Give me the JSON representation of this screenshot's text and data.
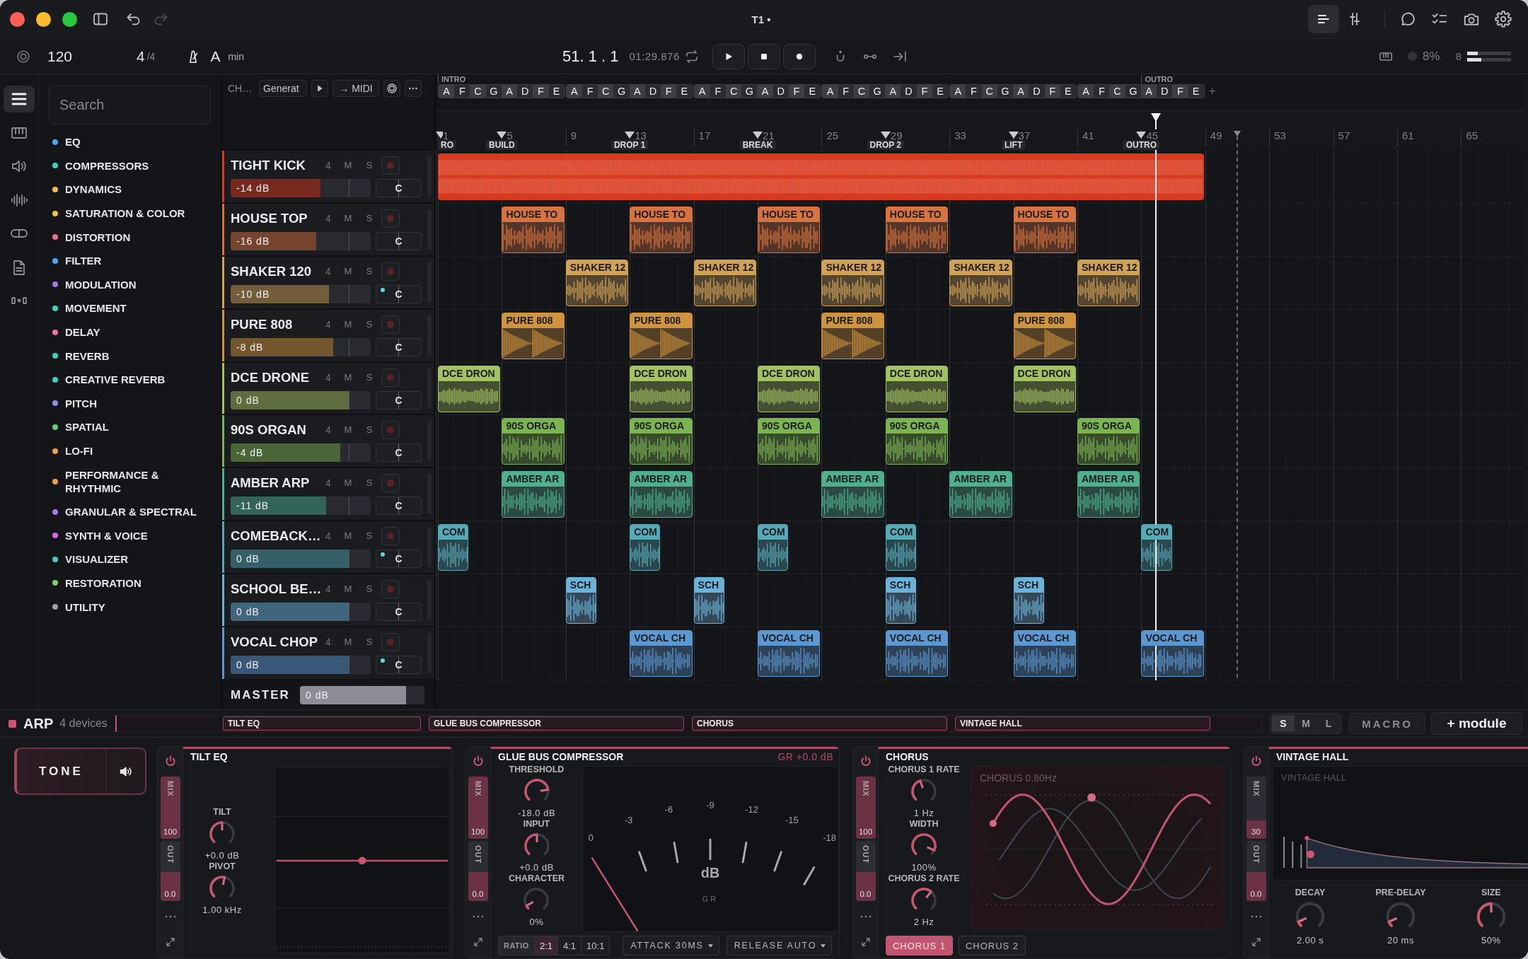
{
  "window": {
    "title": "T1 •"
  },
  "titlebar": {
    "history": [
      {
        "kind": "undo",
        "disabled": false
      },
      {
        "kind": "redo",
        "disabled": true
      }
    ],
    "views": [
      {
        "kind": "arrange",
        "selected": true
      },
      {
        "kind": "mixer",
        "selected": false
      }
    ],
    "tools": [
      {
        "kind": "comments"
      },
      {
        "kind": "tasks"
      },
      {
        "kind": "snapshot"
      },
      {
        "kind": "settings"
      }
    ]
  },
  "transport": {
    "tempo": "120",
    "beats": "4",
    "beat_unit": "/4",
    "key": "A",
    "scale": "min",
    "position": "51. 1 . 1",
    "time": "01:29.876",
    "cpu": "8%",
    "voices": "8",
    "output_meter": [
      {
        "level": 0.24
      },
      {
        "level": 0.32
      }
    ]
  },
  "rail": [
    {
      "kind": "browser",
      "selected": true
    },
    {
      "kind": "piano",
      "selected": false
    },
    {
      "kind": "audio",
      "selected": false
    },
    {
      "kind": "waveform",
      "selected": false
    },
    {
      "kind": "link",
      "selected": false
    },
    {
      "kind": "file",
      "selected": false
    },
    {
      "kind": "dots",
      "selected": false
    }
  ],
  "browser": {
    "search": {
      "placeholder": "Search"
    },
    "categories": [
      {
        "label": "EQ",
        "color": "#4aa8f0"
      },
      {
        "label": "COMPRESSORS",
        "color": "#3fd0bf"
      },
      {
        "label": "DYNAMICS",
        "color": "#f0c04a"
      },
      {
        "label": "SATURATION & COLOR",
        "color": "#f0c04a"
      },
      {
        "label": "DISTORTION",
        "color": "#f06a8a"
      },
      {
        "label": "FILTER",
        "color": "#4aa8f0"
      },
      {
        "label": "MODULATION",
        "color": "#a07cf0"
      },
      {
        "label": "MOVEMENT",
        "color": "#3fd0bf"
      },
      {
        "label": "DELAY",
        "color": "#f070a8"
      },
      {
        "label": "REVERB",
        "color": "#3fd0bf"
      },
      {
        "label": "CREATIVE REVERB",
        "color": "#3fd0bf"
      },
      {
        "label": "PITCH",
        "color": "#8c8cf0"
      },
      {
        "label": "SPATIAL",
        "color": "#62d070"
      },
      {
        "label": "LO-FI",
        "color": "#f0a040"
      },
      {
        "label": "PERFORMANCE & RHYTHMIC",
        "color": "#f0a040"
      },
      {
        "label": "GRANULAR & SPECTRAL",
        "color": "#a07cf0"
      },
      {
        "label": "SYNTH & VOICE",
        "color": "#e060e0"
      },
      {
        "label": "VISUALIZER",
        "color": "#3fd0bf"
      },
      {
        "label": "RESTORATION",
        "color": "#7ad060"
      },
      {
        "label": "UTILITY",
        "color": "#a0a1a8"
      }
    ]
  },
  "track_toolbar": {
    "label": "CH…",
    "generator": "Generat",
    "midi": "→ MIDI"
  },
  "chord_track": {
    "groups": [
      {
        "chords": [
          {
            "name": "A",
            "section": "INTRO"
          },
          {
            "name": "F"
          },
          {
            "name": "C"
          },
          {
            "name": "G"
          },
          {
            "name": "A"
          },
          {
            "name": "D"
          },
          {
            "name": "F"
          },
          {
            "name": "E"
          }
        ]
      },
      {
        "chords": [
          {
            "name": "A"
          },
          {
            "name": "F"
          },
          {
            "name": "C"
          },
          {
            "name": "G"
          },
          {
            "name": "A"
          },
          {
            "name": "D"
          },
          {
            "name": "F"
          },
          {
            "name": "E"
          }
        ]
      },
      {
        "chords": [
          {
            "name": "A"
          },
          {
            "name": "F"
          },
          {
            "name": "C"
          },
          {
            "name": "G"
          },
          {
            "name": "A"
          },
          {
            "name": "D"
          },
          {
            "name": "F"
          },
          {
            "name": "E"
          }
        ]
      },
      {
        "chords": [
          {
            "name": "A"
          },
          {
            "name": "F"
          },
          {
            "name": "C"
          },
          {
            "name": "G"
          },
          {
            "name": "A"
          },
          {
            "name": "D"
          },
          {
            "name": "F"
          },
          {
            "name": "E"
          }
        ]
      },
      {
        "chords": [
          {
            "name": "A"
          },
          {
            "name": "F"
          },
          {
            "name": "C"
          },
          {
            "name": "G"
          },
          {
            "name": "A"
          },
          {
            "name": "D"
          },
          {
            "name": "F"
          },
          {
            "name": "E"
          }
        ]
      },
      {
        "chords": [
          {
            "name": "A"
          },
          {
            "name": "F"
          },
          {
            "name": "C"
          },
          {
            "name": "G"
          },
          {
            "name": "A",
            "section": "OUTRO"
          },
          {
            "name": "D"
          },
          {
            "name": "F"
          },
          {
            "name": "E"
          }
        ]
      }
    ],
    "add": "+"
  },
  "ruler": {
    "numbers": [
      {
        "label": "1",
        "marker": "RO"
      },
      {
        "label": "5",
        "marker": "BUILD"
      },
      {
        "label": "9"
      },
      {
        "label": "13",
        "marker": "DROP 1"
      },
      {
        "label": "17"
      },
      {
        "label": "21",
        "marker": "BREAK"
      },
      {
        "label": "25"
      },
      {
        "label": "29",
        "marker": "DROP 2"
      },
      {
        "label": "33"
      },
      {
        "label": "37",
        "marker": "LIFT"
      },
      {
        "label": "41"
      },
      {
        "label": "45",
        "marker": "OUTRO"
      },
      {
        "label": "49"
      },
      {
        "label": "53"
      },
      {
        "label": "57"
      },
      {
        "label": "61"
      },
      {
        "label": "65"
      }
    ],
    "playhead": {
      "level": 0.661
    },
    "end_marker": {
      "level": 0.736
    }
  },
  "tracks": [
    {
      "name": "TIGHT KICK",
      "color": "#d83a1f",
      "channel": "4",
      "mute": "M",
      "solo": "S",
      "muted": false,
      "soloed": false,
      "armed": false,
      "volume": "-14 dB",
      "level": 0.64,
      "pan": "C",
      "pan_dot": false,
      "clips": [
        {
          "kind": "long"
        },
        {
          "kind": "empty"
        },
        {
          "kind": "empty"
        },
        {
          "kind": "empty"
        },
        {
          "kind": "empty"
        },
        {
          "kind": "empty"
        },
        {
          "kind": "empty"
        },
        {
          "kind": "empty"
        },
        {
          "kind": "empty"
        },
        {
          "kind": "empty"
        },
        {
          "kind": "empty"
        },
        {
          "kind": "empty"
        }
      ]
    },
    {
      "name": "HOUSE TOP",
      "color": "#d6733e",
      "channel": "4",
      "mute": "M",
      "solo": "S",
      "muted": false,
      "soloed": false,
      "armed": false,
      "volume": "-16 dB",
      "level": 0.61,
      "pan": "C",
      "pan_dot": false,
      "clips": [
        {
          "kind": "empty"
        },
        {
          "kind": "clip",
          "label": "HOUSE TO"
        },
        {
          "kind": "empty"
        },
        {
          "kind": "clip",
          "label": "HOUSE TO"
        },
        {
          "kind": "empty"
        },
        {
          "kind": "clip",
          "label": "HOUSE TO"
        },
        {
          "kind": "empty"
        },
        {
          "kind": "clip",
          "label": "HOUSE TO"
        },
        {
          "kind": "empty"
        },
        {
          "kind": "clip",
          "label": "HOUSE TO"
        },
        {
          "kind": "empty"
        },
        {
          "kind": "empty"
        }
      ]
    },
    {
      "name": "SHAKER 120",
      "color": "#d0a258",
      "channel": "4",
      "mute": "M",
      "solo": "S",
      "muted": false,
      "soloed": false,
      "armed": false,
      "volume": "-10 dB",
      "level": 0.7,
      "pan": "C",
      "pan_dot": true,
      "clips": [
        {
          "kind": "empty"
        },
        {
          "kind": "empty"
        },
        {
          "kind": "clip",
          "label": "SHAKER 12"
        },
        {
          "kind": "empty"
        },
        {
          "kind": "clip",
          "label": "SHAKER 12"
        },
        {
          "kind": "empty"
        },
        {
          "kind": "clip",
          "label": "SHAKER 12"
        },
        {
          "kind": "empty"
        },
        {
          "kind": "clip",
          "label": "SHAKER 12"
        },
        {
          "kind": "empty"
        },
        {
          "kind": "clip",
          "label": "SHAKER 12"
        },
        {
          "kind": "empty"
        }
      ]
    },
    {
      "name": "PURE 808",
      "color": "#d0943f",
      "channel": "4",
      "mute": "M",
      "solo": "S",
      "muted": false,
      "soloed": false,
      "armed": false,
      "volume": "-8 dB",
      "level": 0.73,
      "pan": "C",
      "pan_dot": false,
      "clips": [
        {
          "kind": "empty"
        },
        {
          "kind": "clip",
          "label": "PURE 808"
        },
        {
          "kind": "empty"
        },
        {
          "kind": "clip",
          "label": "PURE 808"
        },
        {
          "kind": "empty"
        },
        {
          "kind": "empty"
        },
        {
          "kind": "clip",
          "label": "PURE 808"
        },
        {
          "kind": "empty"
        },
        {
          "kind": "empty"
        },
        {
          "kind": "clip",
          "label": "PURE 808"
        },
        {
          "kind": "empty"
        },
        {
          "kind": "empty"
        }
      ]
    },
    {
      "name": "DCE DRONE",
      "color": "#a3c262",
      "channel": "4",
      "mute": "M",
      "solo": "S",
      "muted": false,
      "soloed": false,
      "armed": false,
      "volume": "0 dB",
      "level": 0.845,
      "pan": "C",
      "pan_dot": false,
      "clips": [
        {
          "kind": "clip",
          "label": "DCE DRON"
        },
        {
          "kind": "empty"
        },
        {
          "kind": "empty"
        },
        {
          "kind": "clip",
          "label": "DCE DRON"
        },
        {
          "kind": "empty"
        },
        {
          "kind": "clip",
          "label": "DCE DRON"
        },
        {
          "kind": "empty"
        },
        {
          "kind": "clip",
          "label": "DCE DRON"
        },
        {
          "kind": "empty"
        },
        {
          "kind": "clip",
          "label": "DCE DRON"
        },
        {
          "kind": "empty"
        },
        {
          "kind": "empty"
        }
      ]
    },
    {
      "name": "90S ORGAN",
      "color": "#7db452",
      "channel": "4",
      "mute": "M",
      "solo": "S",
      "muted": false,
      "soloed": false,
      "armed": false,
      "volume": "-4 dB",
      "level": 0.785,
      "pan": "C",
      "pan_dot": false,
      "clips": [
        {
          "kind": "empty"
        },
        {
          "kind": "clip",
          "label": "90S ORGA"
        },
        {
          "kind": "empty"
        },
        {
          "kind": "clip",
          "label": "90S ORGA"
        },
        {
          "kind": "empty"
        },
        {
          "kind": "clip",
          "label": "90S ORGA"
        },
        {
          "kind": "empty"
        },
        {
          "kind": "clip",
          "label": "90S ORGA"
        },
        {
          "kind": "empty"
        },
        {
          "kind": "empty"
        },
        {
          "kind": "clip",
          "label": "90S ORGA"
        },
        {
          "kind": "empty"
        }
      ]
    },
    {
      "name": "AMBER ARP",
      "color": "#4fb08e",
      "channel": "4",
      "mute": "M",
      "solo": "S",
      "muted": false,
      "soloed": false,
      "armed": false,
      "volume": "-11 dB",
      "level": 0.68,
      "pan": "C",
      "pan_dot": false,
      "clips": [
        {
          "kind": "empty"
        },
        {
          "kind": "clip",
          "label": "AMBER AR"
        },
        {
          "kind": "empty"
        },
        {
          "kind": "clip",
          "label": "AMBER AR"
        },
        {
          "kind": "empty"
        },
        {
          "kind": "empty"
        },
        {
          "kind": "clip",
          "label": "AMBER AR"
        },
        {
          "kind": "empty"
        },
        {
          "kind": "clip",
          "label": "AMBER AR"
        },
        {
          "kind": "empty"
        },
        {
          "kind": "clip",
          "label": "AMBER AR"
        },
        {
          "kind": "empty"
        }
      ]
    },
    {
      "name": "COMEBACK…",
      "color": "#56a9b6",
      "channel": "4",
      "mute": "M",
      "solo": "S",
      "muted": false,
      "soloed": false,
      "armed": false,
      "volume": "0 dB",
      "level": 0.845,
      "pan": "C",
      "pan_dot": true,
      "clips": [
        {
          "kind": "short",
          "label": "COM"
        },
        {
          "kind": "empty"
        },
        {
          "kind": "empty"
        },
        {
          "kind": "short",
          "label": "COM"
        },
        {
          "kind": "empty"
        },
        {
          "kind": "short",
          "label": "COM"
        },
        {
          "kind": "empty"
        },
        {
          "kind": "short",
          "label": "COM"
        },
        {
          "kind": "empty"
        },
        {
          "kind": "empty"
        },
        {
          "kind": "empty"
        },
        {
          "kind": "short",
          "label": "COM"
        }
      ]
    },
    {
      "name": "SCHOOL BE…",
      "color": "#6cb2d8",
      "channel": "4",
      "mute": "M",
      "solo": "S",
      "muted": false,
      "soloed": false,
      "armed": false,
      "volume": "0 dB",
      "level": 0.845,
      "pan": "C",
      "pan_dot": false,
      "clips": [
        {
          "kind": "empty"
        },
        {
          "kind": "empty"
        },
        {
          "kind": "short",
          "label": "SCH"
        },
        {
          "kind": "empty"
        },
        {
          "kind": "short",
          "label": "SCH"
        },
        {
          "kind": "empty"
        },
        {
          "kind": "empty"
        },
        {
          "kind": "short",
          "label": "SCH"
        },
        {
          "kind": "empty"
        },
        {
          "kind": "short",
          "label": "SCH"
        },
        {
          "kind": "empty"
        },
        {
          "kind": "empty"
        }
      ]
    },
    {
      "name": "VOCAL CHOP",
      "color": "#5b97d0",
      "channel": "4",
      "mute": "M",
      "solo": "S",
      "muted": false,
      "soloed": false,
      "armed": false,
      "volume": "0 dB",
      "level": 0.845,
      "pan": "C",
      "pan_dot": true,
      "clips": [
        {
          "kind": "empty"
        },
        {
          "kind": "empty"
        },
        {
          "kind": "empty"
        },
        {
          "kind": "clip",
          "label": "VOCAL CH"
        },
        {
          "kind": "empty"
        },
        {
          "kind": "clip",
          "label": "VOCAL CH"
        },
        {
          "kind": "empty"
        },
        {
          "kind": "clip",
          "label": "VOCAL CH"
        },
        {
          "kind": "empty"
        },
        {
          "kind": "clip",
          "label": "VOCAL CH"
        },
        {
          "kind": "empty"
        },
        {
          "kind": "clip",
          "label": "VOCAL CH"
        }
      ]
    }
  ],
  "master": {
    "label": "MASTER",
    "volume": "0 dB",
    "level": 0.85
  },
  "chain": {
    "name": "ARP",
    "count": "4 devices",
    "segments": [
      "TILT EQ",
      "GLUE BUS COMPRESSOR",
      "CHORUS",
      "VINTAGE HALL"
    ],
    "sizes": [
      {
        "label": "S",
        "selected": true
      },
      {
        "label": "M",
        "selected": false
      },
      {
        "label": "L",
        "selected": false
      }
    ],
    "macro": "MACRO",
    "add_module": "+ module"
  },
  "tone": {
    "label": "TONE"
  },
  "devices": [
    {
      "kind": "tilt_eq",
      "title": "TILT EQ",
      "enabled": true,
      "mix": {
        "label": "MIX",
        "value": "100",
        "level": 1
      },
      "out": {
        "label": "OUT",
        "value": "0.0",
        "level": 0.48
      },
      "knobs": [
        {
          "name": "TILT",
          "reading": "+0.0 dB",
          "level": 0.5
        },
        {
          "name": "PIVOT",
          "reading": "1.00 kHz",
          "level": 0.55
        }
      ]
    },
    {
      "kind": "compressor",
      "title": "GLUE BUS COMPRESSOR",
      "gr_reading": "GR +0.0 dB",
      "enabled": true,
      "mix": {
        "label": "MIX",
        "value": "100",
        "level": 1
      },
      "out": {
        "label": "OUT",
        "value": "0.0",
        "level": 0.48
      },
      "knobs": [
        {
          "name": "THRESHOLD",
          "reading": "-18.0 dB",
          "level": 0.8
        },
        {
          "name": "INPUT",
          "reading": "+0.0 dB",
          "level": 0.5
        },
        {
          "name": "CHARACTER",
          "reading": "0%",
          "level": 0.06
        }
      ],
      "meter": {
        "scale": [
          "0",
          "-3",
          "-6",
          "-9",
          "-12",
          "-15",
          "-18"
        ],
        "unit": "dB",
        "caption": "GR"
      },
      "ratio": {
        "label": "RATIO",
        "options": [
          {
            "label": "2:1",
            "selected": true
          },
          {
            "label": "4:1",
            "selected": false
          },
          {
            "label": "10:1",
            "selected": false
          }
        ]
      },
      "menus": [
        "ATTACK 30MS",
        "RELEASE AUTO"
      ]
    },
    {
      "kind": "chorus",
      "title": "CHORUS",
      "enabled": true,
      "mix": {
        "label": "MIX",
        "value": "100",
        "level": 1
      },
      "out": {
        "label": "OUT",
        "value": "0.0",
        "level": 0.48
      },
      "knobs": [
        {
          "name": "CHORUS 1 RATE",
          "reading": "1 Hz",
          "level": 0.43
        },
        {
          "name": "WIDTH",
          "reading": "100%",
          "level": 0.92
        },
        {
          "name": "CHORUS 2 RATE",
          "reading": "2 Hz",
          "level": 0.65
        }
      ],
      "graph_label": "CHORUS 0.80Hz",
      "tabs": [
        {
          "label": "CHORUS 1",
          "selected": true
        },
        {
          "label": "CHORUS 2",
          "selected": false
        }
      ]
    },
    {
      "kind": "reverb",
      "title": "VINTAGE HALL",
      "enabled": true,
      "mix": {
        "label": "MIX",
        "value": "30",
        "level": 0.3
      },
      "out": {
        "label": "OUT",
        "value": "0.0",
        "level": 0.48
      },
      "graph_label": "VINTAGE HALL",
      "knobs": [
        {
          "name": "DECAY",
          "reading": "2.00 s",
          "level": 0.08
        },
        {
          "name": "PRE-DELAY",
          "reading": "20 ms",
          "level": 0.08
        },
        {
          "name": "SIZE",
          "reading": "50%",
          "level": 0.5
        }
      ]
    }
  ]
}
